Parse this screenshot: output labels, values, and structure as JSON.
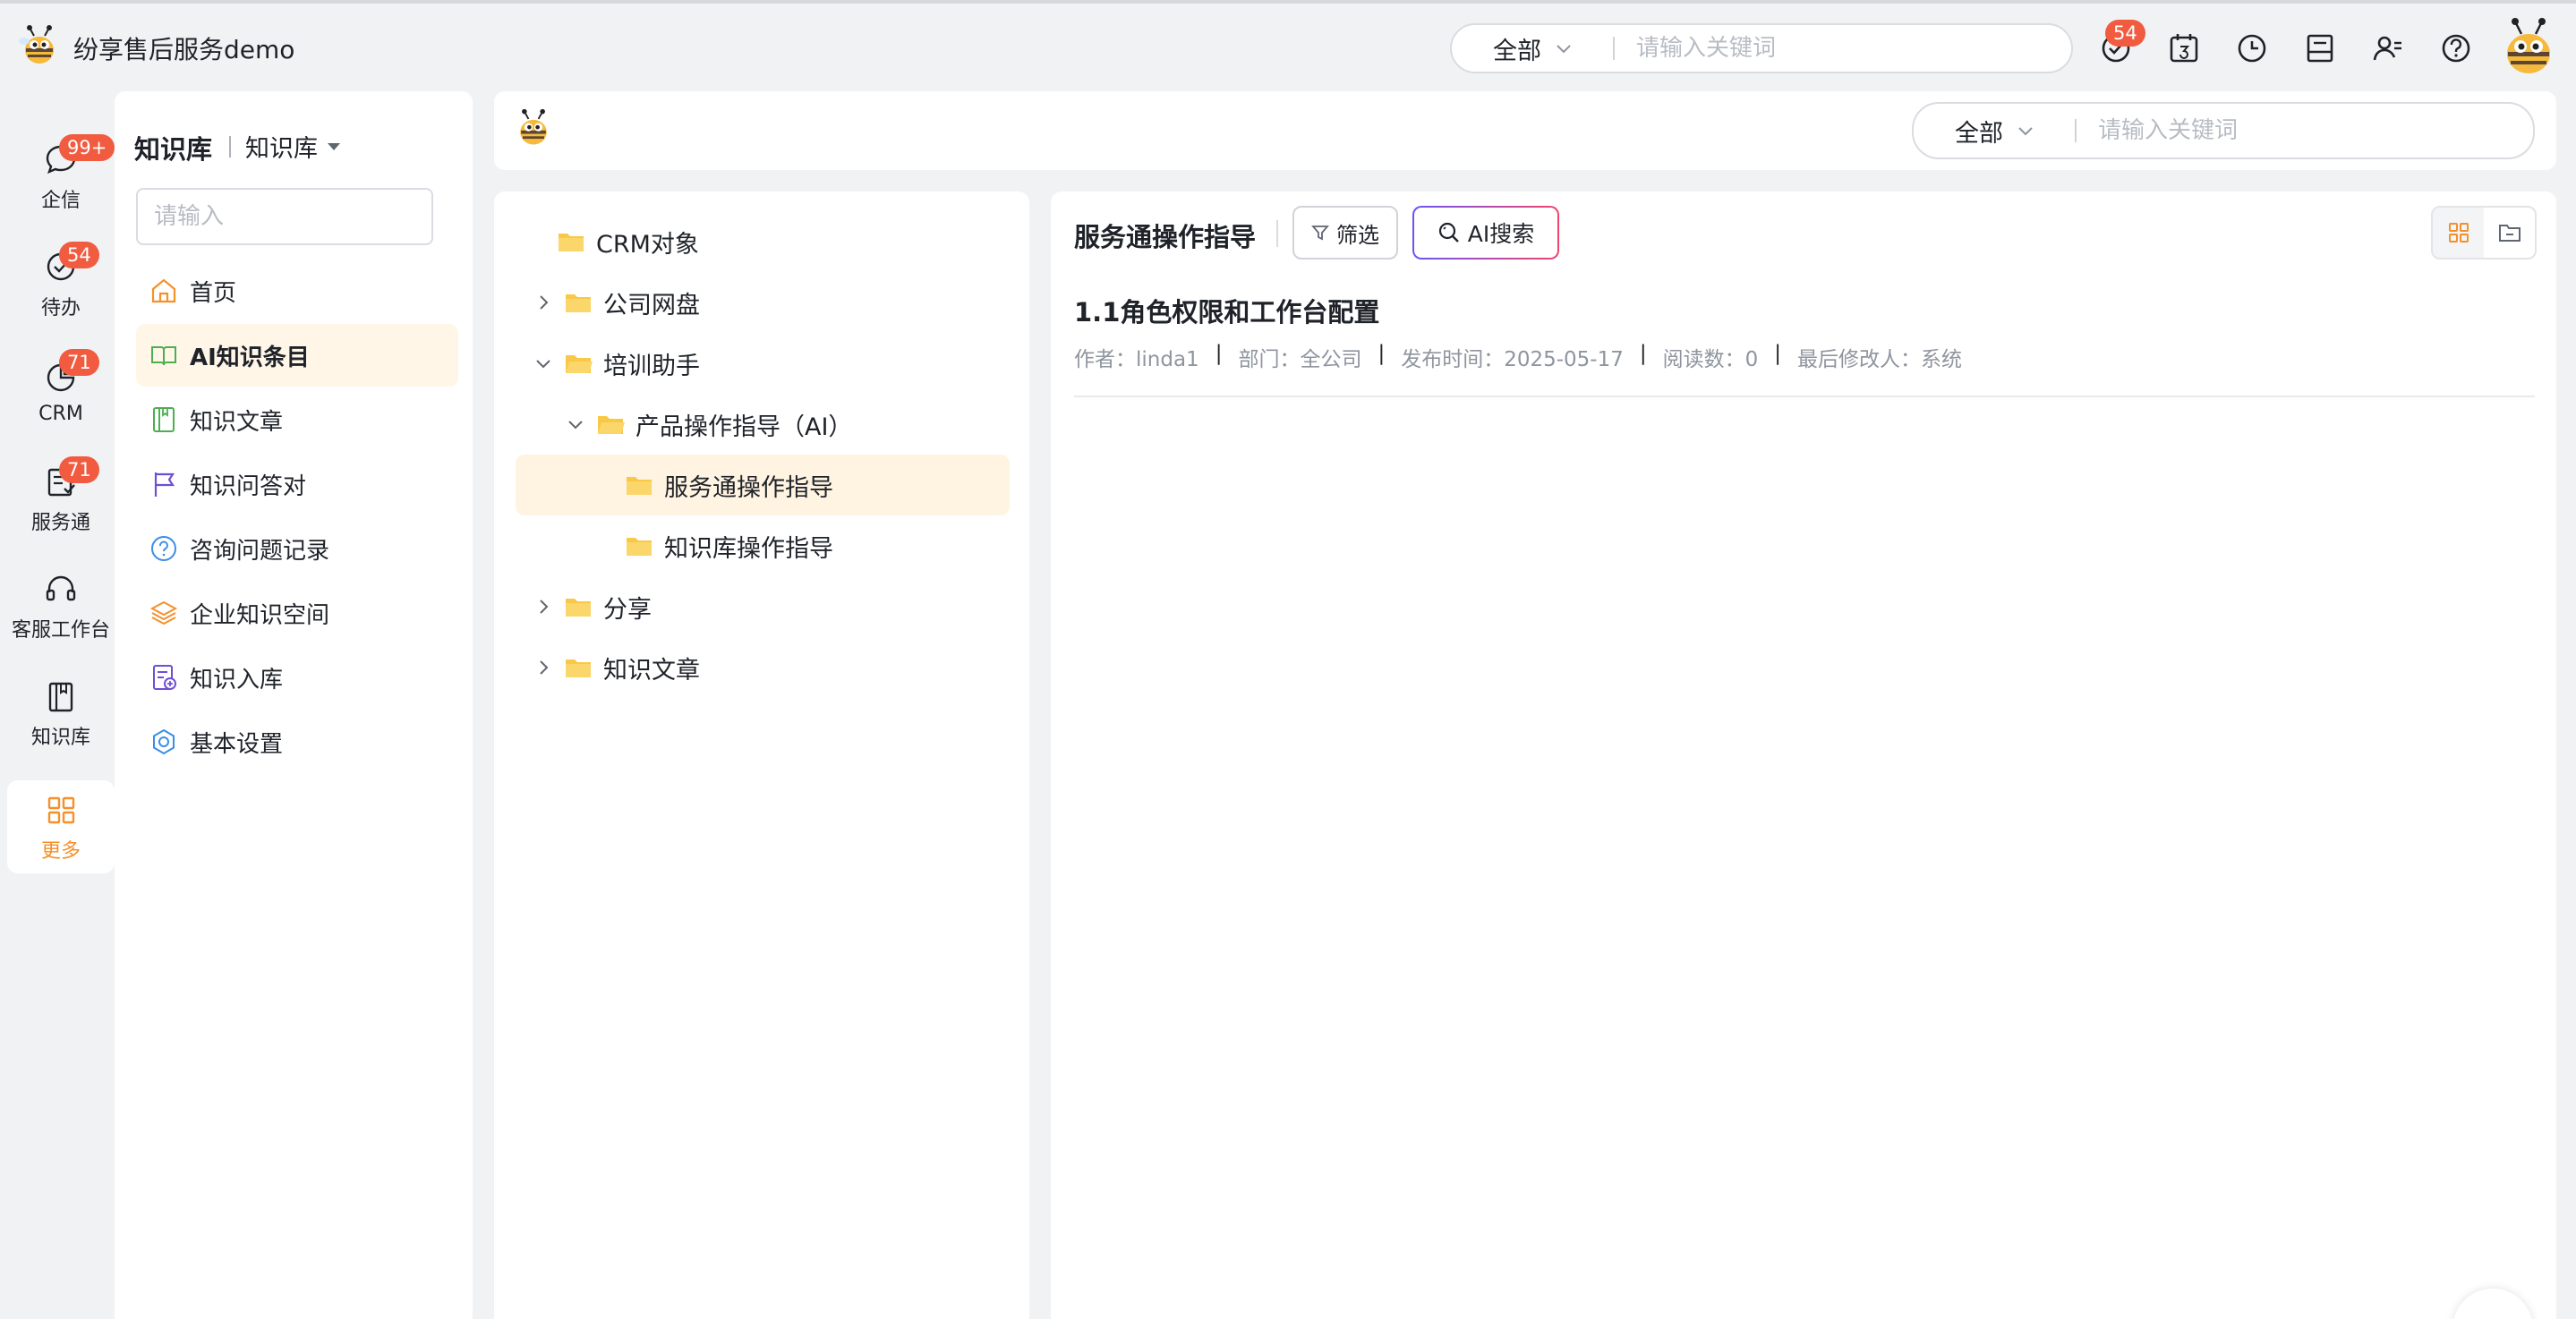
{
  "app": {
    "title": "纷享售后服务demo"
  },
  "top_search": {
    "scope": "全部",
    "placeholder": "请输入关键词"
  },
  "top_badges": {
    "todo": "54"
  },
  "rail": [
    {
      "label": "企信",
      "badge": "99+"
    },
    {
      "label": "待办",
      "badge": "54"
    },
    {
      "label": "CRM",
      "badge": "71"
    },
    {
      "label": "服务通",
      "badge": "71"
    },
    {
      "label": "客服工作台",
      "badge": ""
    },
    {
      "label": "知识库",
      "badge": ""
    },
    {
      "label": "更多",
      "badge": ""
    }
  ],
  "menu": {
    "title": "知识库",
    "subtitle": "知识库",
    "search_placeholder": "请输入",
    "items": [
      {
        "label": "首页"
      },
      {
        "label": "AI知识条目"
      },
      {
        "label": "知识文章"
      },
      {
        "label": "知识问答对"
      },
      {
        "label": "咨询问题记录"
      },
      {
        "label": "企业知识空间"
      },
      {
        "label": "知识入库"
      },
      {
        "label": "基本设置"
      }
    ]
  },
  "content_search": {
    "scope": "全部",
    "placeholder": "请输入关键词"
  },
  "tree": [
    {
      "label": "CRM对象"
    },
    {
      "label": "公司网盘"
    },
    {
      "label": "培训助手"
    },
    {
      "label": "产品操作指导（AI）"
    },
    {
      "label": "服务通操作指导"
    },
    {
      "label": "知识库操作指导"
    },
    {
      "label": "分享"
    },
    {
      "label": "知识文章"
    }
  ],
  "list": {
    "title": "服务通操作指导",
    "filter_label": "筛选",
    "ai_label": "AI搜索",
    "article": {
      "title": "1.1角色权限和工作台配置",
      "meta": [
        "作者：linda1",
        "部门：全公司",
        "发布时间：2025-05-17",
        "阅读数：0",
        "最后修改人：系统"
      ]
    }
  },
  "colors": {
    "accent": "#f5902a",
    "badge": "#f15b40",
    "selected_bg": "#fff6e8",
    "folder": "#f9c846"
  }
}
